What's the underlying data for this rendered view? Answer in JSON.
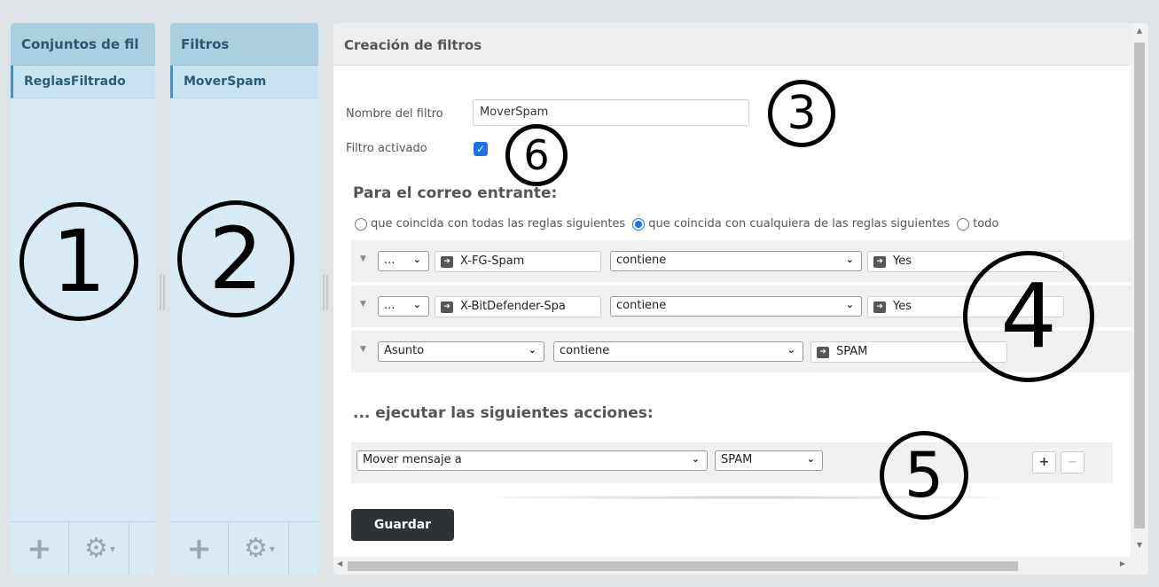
{
  "sets_panel": {
    "header": "Conjuntos de fil",
    "items": [
      {
        "label": "ReglasFiltrado"
      }
    ],
    "add_icon": "plus-icon",
    "gear_icon": "gear-icon",
    "annotation": "1"
  },
  "filters_panel": {
    "header": "Filtros",
    "items": [
      {
        "label": "MoverSpam"
      }
    ],
    "add_icon": "plus-icon",
    "gear_icon": "gear-icon",
    "annotation": "2"
  },
  "editor": {
    "header": "Creación de filtros",
    "name_label": "Nombre del filtro",
    "name_value": "MoverSpam",
    "active_label": "Filtro activado",
    "active_checked": true,
    "incoming_title": "Para el correo entrante:",
    "match_options": [
      {
        "label": "que coincida con todas las reglas siguientes",
        "selected": false
      },
      {
        "label": "que coincida con cualquiera de las reglas siguientes",
        "selected": true
      },
      {
        "label": "todo",
        "selected": false
      }
    ],
    "rules": [
      {
        "field": "...",
        "header": "X-FG-Spam",
        "operator": "contiene",
        "value": "Yes"
      },
      {
        "field": "...",
        "header": "X-BitDefender-Spa",
        "operator": "contiene",
        "value": "Yes"
      },
      {
        "field": "Asunto",
        "operator": "contiene",
        "value": "SPAM"
      }
    ],
    "actions_title": "... ejecutar las siguientes acciones:",
    "action": {
      "type": "Mover mensaje a",
      "target": "SPAM",
      "add_label": "+",
      "remove_label": "−"
    },
    "save_label": "Guardar",
    "annotations": {
      "name": "3",
      "rules": "4",
      "actions": "5",
      "active": "6"
    }
  },
  "colors": {
    "panel_bg": "#d8ebf4",
    "panel_header": "#a9cfe0",
    "accent": "#1a73e8",
    "save_button": "#2f3337"
  }
}
